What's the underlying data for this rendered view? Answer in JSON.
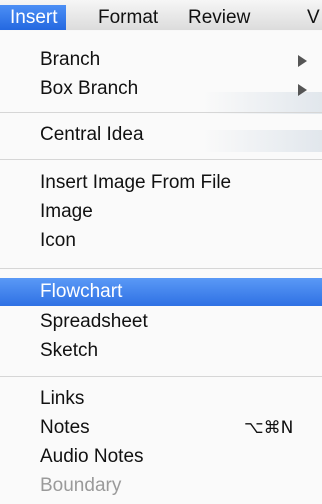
{
  "menubar": {
    "items": [
      {
        "label": "Insert",
        "active": true
      },
      {
        "label": "Format",
        "active": false
      },
      {
        "label": "Review",
        "active": false
      },
      {
        "label": "V",
        "active": false
      }
    ]
  },
  "menu": {
    "items": [
      {
        "label": "Branch",
        "submenu": true
      },
      {
        "label": "Box Branch",
        "submenu": true
      },
      {
        "label": "Central Idea"
      },
      {
        "label": "Insert Image From File"
      },
      {
        "label": "Image"
      },
      {
        "label": "Icon"
      },
      {
        "label": "Flowchart",
        "highlighted": true
      },
      {
        "label": "Spreadsheet"
      },
      {
        "label": "Sketch"
      },
      {
        "label": "Links"
      },
      {
        "label": "Notes",
        "shortcut": "⌥⌘N"
      },
      {
        "label": "Audio Notes"
      },
      {
        "label": "Boundary",
        "disabled": true
      }
    ]
  },
  "colors": {
    "highlight": "#3b7eea",
    "disabled_text": "#9a9a9a",
    "menubar_bg": "#dcdcdc"
  }
}
